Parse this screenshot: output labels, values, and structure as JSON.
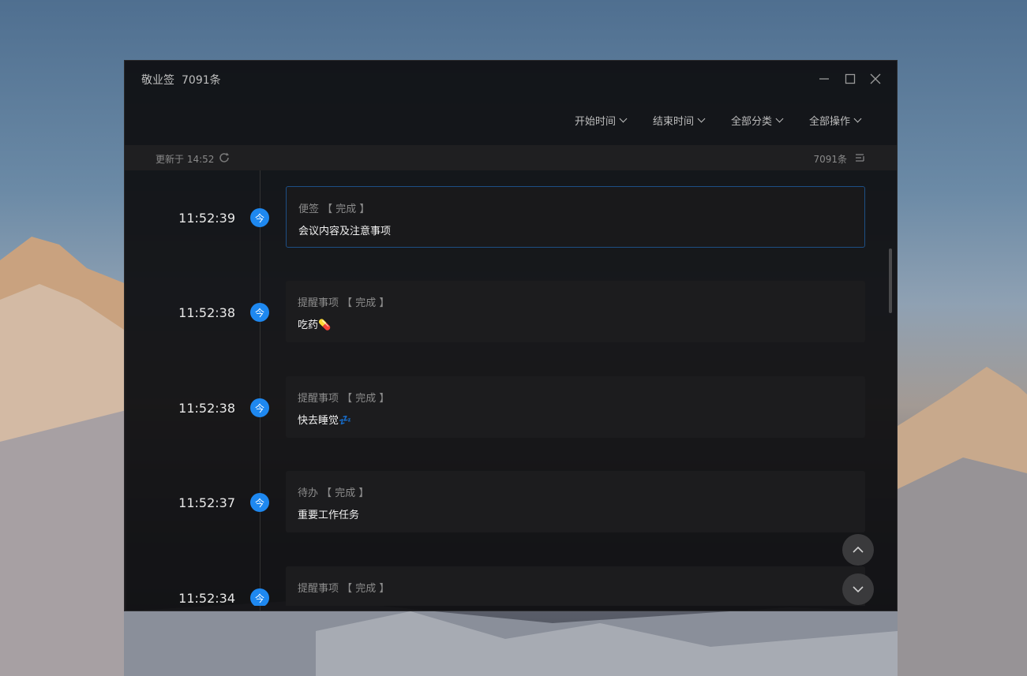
{
  "app": {
    "title": "敬业签",
    "count": "7091条"
  },
  "window_controls": {
    "minimize": "minimize-icon",
    "maximize": "maximize-icon",
    "close": "close-icon"
  },
  "filters": [
    {
      "label": "开始时间"
    },
    {
      "label": "结束时间"
    },
    {
      "label": "全部分类"
    },
    {
      "label": "全部操作"
    }
  ],
  "status": {
    "updated": "更新于 14:52",
    "total": "7091条"
  },
  "entries": [
    {
      "time": "11:52:39",
      "badge": "今",
      "meta": "便签 【 完成 】",
      "content": "会议内容及注意事项",
      "active": true
    },
    {
      "time": "11:52:38",
      "badge": "今",
      "meta": "提醒事项 【 完成 】",
      "content": "吃药💊"
    },
    {
      "time": "11:52:38",
      "badge": "今",
      "meta": "提醒事项 【 完成 】",
      "content": "快去睡觉💤"
    },
    {
      "time": "11:52:37",
      "badge": "今",
      "meta": "待办 【 完成 】",
      "content": "重要工作任务"
    },
    {
      "time": "11:52:34",
      "badge": "今",
      "meta": "提醒事项 【 完成 】",
      "content": ""
    }
  ],
  "colors": {
    "accent": "#1e88f0",
    "window_bg": "#0e0e10",
    "card_bg": "#1c1c1e"
  }
}
